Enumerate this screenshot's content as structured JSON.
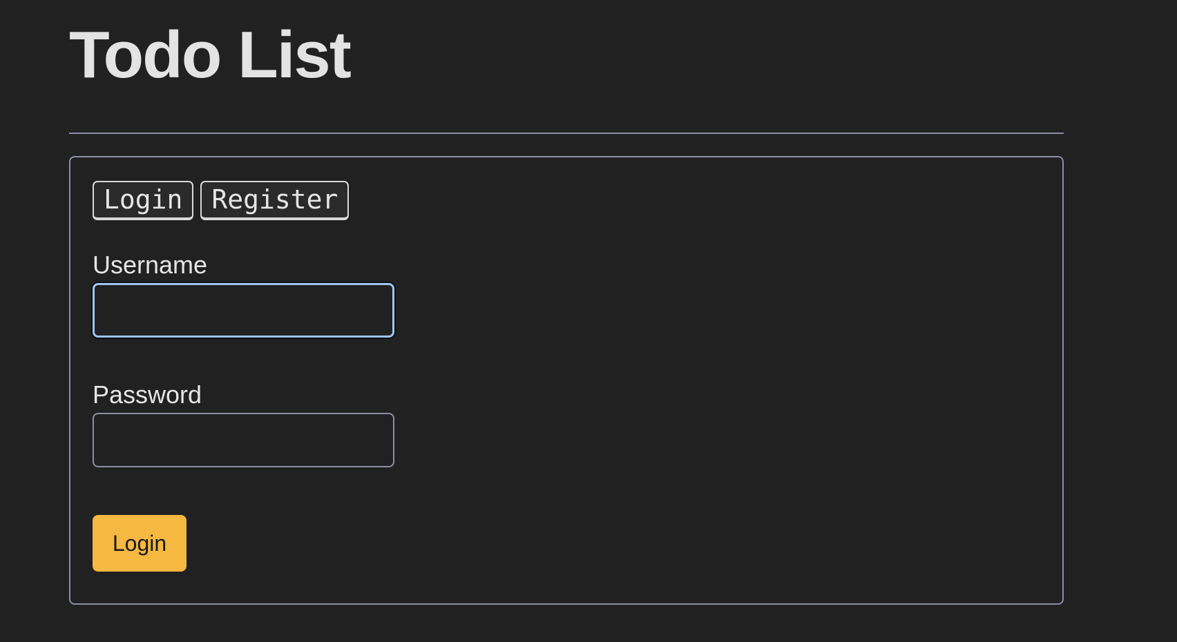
{
  "page": {
    "title": "Todo List"
  },
  "auth": {
    "tabs": [
      {
        "label": "Login"
      },
      {
        "label": "Register"
      }
    ],
    "username": {
      "label": "Username",
      "value": "",
      "placeholder": ""
    },
    "password": {
      "label": "Password",
      "value": "",
      "placeholder": ""
    },
    "submit_label": "Login"
  },
  "colors": {
    "background": "#212121",
    "border": "#8c90a3",
    "focus": "#9ec5f2",
    "accent": "#f5b841"
  }
}
